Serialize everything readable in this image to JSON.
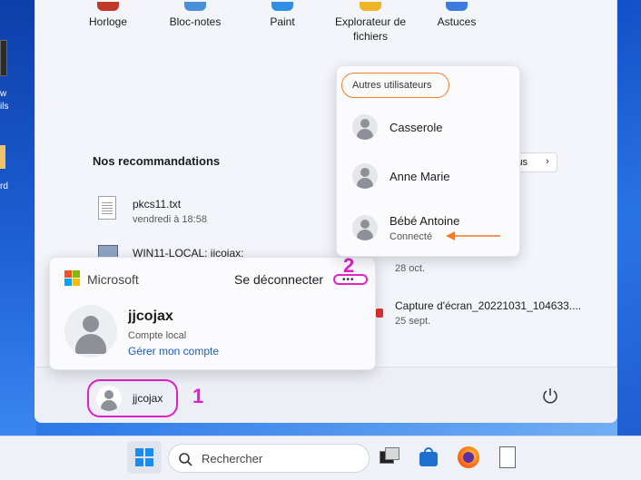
{
  "desktop": {
    "left_labels": [
      "w",
      "ils",
      "rd"
    ]
  },
  "start_menu": {
    "pinned_apps": [
      {
        "label": "Horloge",
        "icon": "clock-icon",
        "color": "#c0392b"
      },
      {
        "label": "Bloc-notes",
        "icon": "notepad-icon",
        "color": "#4a90d9"
      },
      {
        "label": "Paint",
        "icon": "paint-icon",
        "color": "#2f8ee5"
      },
      {
        "label": "Explorateur de fichiers",
        "icon": "folder-icon",
        "color": "#f0b429"
      },
      {
        "label": "Astuces",
        "icon": "tips-icon",
        "color": "#3d7be0"
      }
    ],
    "recommendations_title": "Nos recommandations",
    "more_button_fragment": "lus",
    "recommendations": [
      {
        "name": "pkcs11.txt",
        "date": "vendredi à 18:58",
        "icon": "text-file-icon"
      },
      {
        "name": "WIN11-LOCAL: jjcojax:",
        "date": "",
        "icon": "network-icon"
      },
      {
        "name": "",
        "date": "28 oct.",
        "icon": "file-icon"
      },
      {
        "name": "Capture d'écran_20221031_104633....",
        "date": "25 sept.",
        "icon": "screenshot-icon"
      }
    ],
    "footer": {
      "user_name": "jjcojax",
      "power_icon": "power-icon"
    }
  },
  "account_card": {
    "brand": "Microsoft",
    "sign_out": "Se déconnecter",
    "more_icon": "more-icon",
    "user_name": "jjcojax",
    "account_type": "Compte local",
    "manage_link": "Gérer mon compte"
  },
  "other_users": {
    "heading": "Autres utilisateurs",
    "users": [
      {
        "name": "Casserole",
        "status": ""
      },
      {
        "name": "Anne Marie",
        "status": ""
      },
      {
        "name": "Bébé Antoine",
        "status": "Connecté"
      }
    ]
  },
  "annotations": {
    "one": "1",
    "two": "2",
    "color_pink": "#e020c8",
    "color_orange": "#f07b2a"
  },
  "taskbar": {
    "search_placeholder": "Rechercher",
    "icons": [
      "start-icon",
      "task-view-icon",
      "store-icon",
      "firefox-icon",
      "document-icon"
    ]
  }
}
